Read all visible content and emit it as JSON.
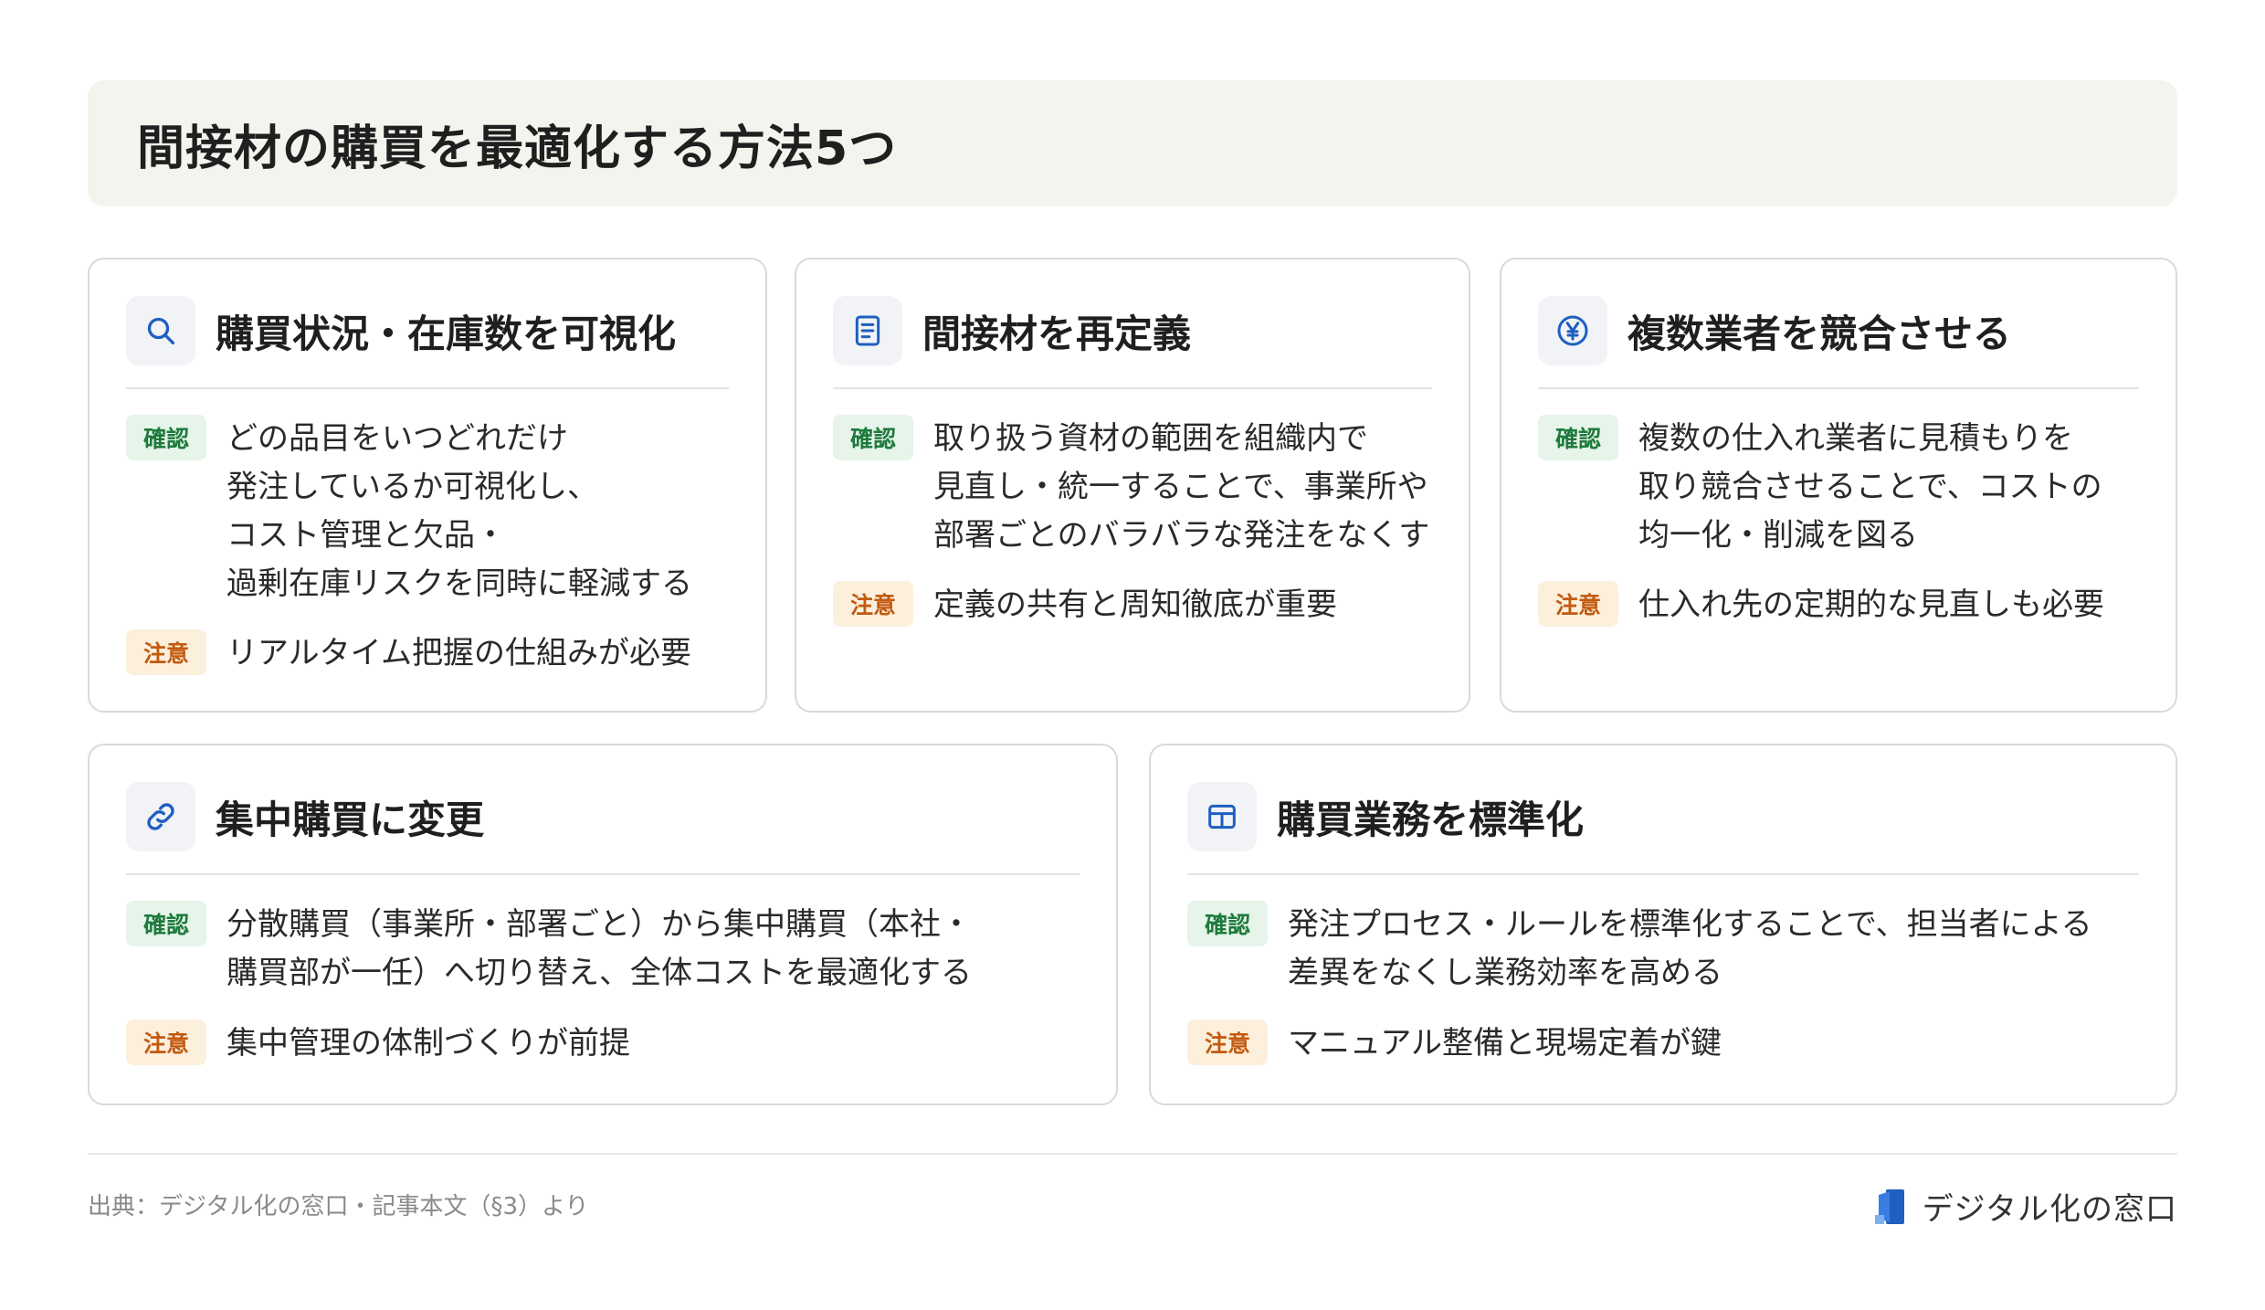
{
  "title": "間接材の購買を最適化する方法5つ",
  "labels": {
    "confirm": "確認",
    "caution": "注意"
  },
  "cards": [
    {
      "title": "購買状況・在庫数を可視化",
      "icon": "search-icon",
      "confirm_lines": [
        "どの品目をいつどれだけ",
        "発注しているか可視化し、",
        "コスト管理と欠品・",
        "過剰在庫リスクを同時に軽減する"
      ],
      "caution": "リアルタイム把握の仕組みが必要"
    },
    {
      "title": "間接材を再定義",
      "icon": "document-icon",
      "confirm_lines": [
        "取り扱う資材の範囲を組織内で",
        "見直し・統一することで、事業所や",
        "部署ごとのバラバラな発注をなくす"
      ],
      "caution": "定義の共有と周知徹底が重要"
    },
    {
      "title": "複数業者を競合させる",
      "icon": "yen-icon",
      "confirm_lines": [
        "複数の仕入れ業者に見積もりを",
        "取り競合させることで、コストの",
        "均一化・削減を図る"
      ],
      "caution": "仕入れ先の定期的な見直しも必要"
    },
    {
      "title": "集中購買に変更",
      "icon": "link-icon",
      "confirm_lines": [
        "分散購買（事業所・部署ごと）から集中購買（本社・",
        "購買部が一任）へ切り替え、全体コストを最適化する"
      ],
      "caution": "集中管理の体制づくりが前提"
    },
    {
      "title": "購買業務を標準化",
      "icon": "grid-icon",
      "confirm_lines": [
        "発注プロセス・ルールを標準化することで、担当者による",
        "差異をなくし業務効率を高める"
      ],
      "caution": "マニュアル整備と現場定着が鍵"
    }
  ],
  "footer": {
    "source": "出典：デジタル化の窓口・記事本文（§3）より",
    "brand": "デジタル化の窓口"
  },
  "colors": {
    "accent": "#1f5fbf",
    "confirm": "#1e7a3c",
    "caution": "#c25a10"
  }
}
